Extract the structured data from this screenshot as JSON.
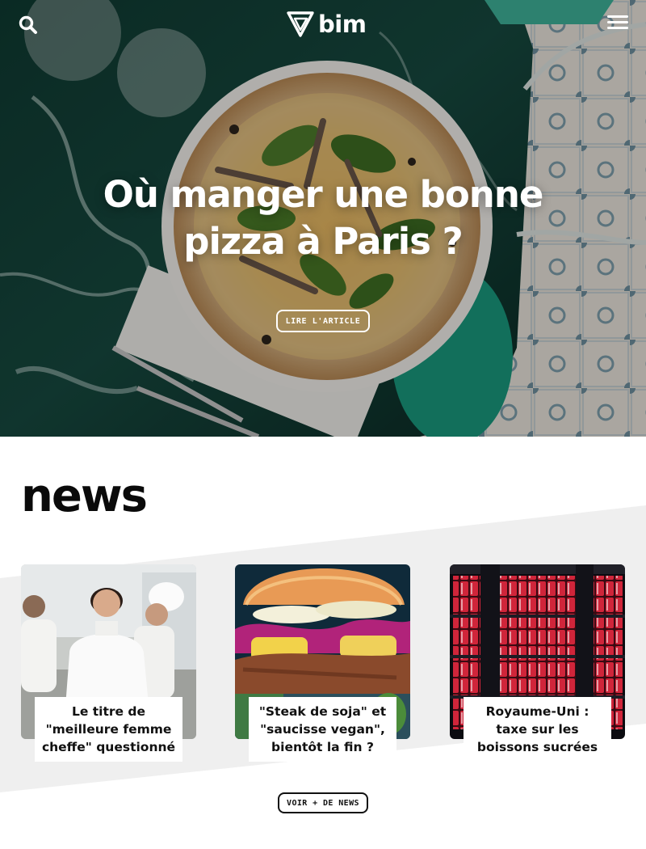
{
  "header": {
    "logo_text": "bim",
    "search_icon": "search-icon",
    "menu_icon": "hamburger-menu-icon"
  },
  "hero": {
    "title": "Où manger une bonne pizza à Paris ?",
    "cta_label": "LIRE L'ARTICLE"
  },
  "news": {
    "heading": "news",
    "cards": [
      {
        "title": "Le titre de \"meilleure femme cheffe\" questionné"
      },
      {
        "title": "\"Steak de soja\" et \"saucisse vegan\", bientôt la fin ?"
      },
      {
        "title": "Royaume-Uni : taxe sur les boissons sucrées"
      }
    ],
    "more_label": "VOIR + DE NEWS"
  },
  "colors": {
    "hero_text": "#ffffff",
    "page_background": "#ffffff",
    "news_band": "#efefef",
    "text_dark": "#111111"
  }
}
